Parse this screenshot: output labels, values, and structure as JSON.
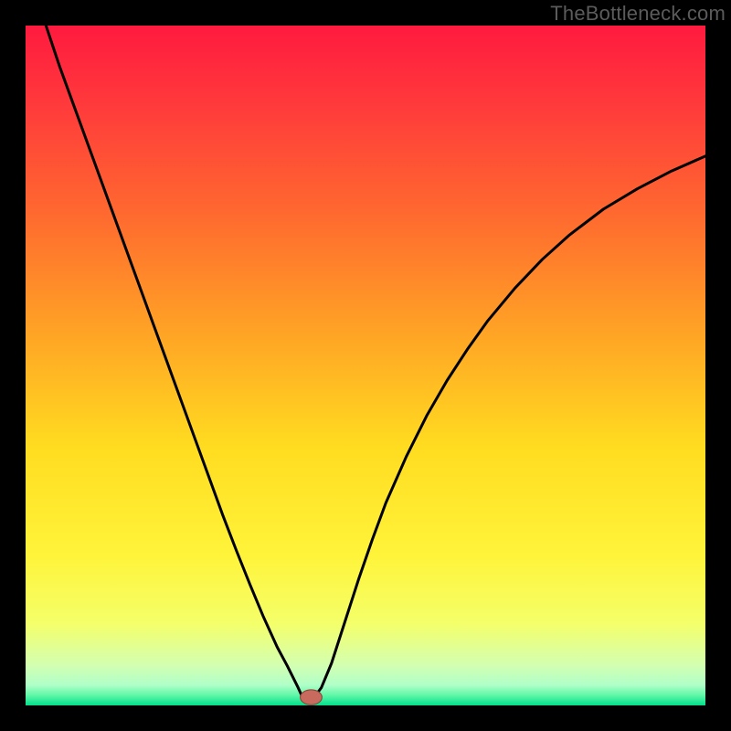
{
  "watermark": "TheBottleneck.com",
  "colors": {
    "frame": "#000000",
    "gradient_stops": [
      {
        "offset": 0.0,
        "color": "#ff1a3f"
      },
      {
        "offset": 0.12,
        "color": "#ff3b3b"
      },
      {
        "offset": 0.28,
        "color": "#ff6a2f"
      },
      {
        "offset": 0.45,
        "color": "#ffa325"
      },
      {
        "offset": 0.62,
        "color": "#ffdc20"
      },
      {
        "offset": 0.78,
        "color": "#fff43a"
      },
      {
        "offset": 0.88,
        "color": "#f4ff6a"
      },
      {
        "offset": 0.94,
        "color": "#d4ffb0"
      },
      {
        "offset": 0.97,
        "color": "#b0ffc8"
      },
      {
        "offset": 0.985,
        "color": "#60f7a8"
      },
      {
        "offset": 1.0,
        "color": "#00e08a"
      }
    ],
    "curve": "#000000",
    "marker_fill": "#c96a5e",
    "marker_stroke": "#8a3f36"
  },
  "chart_data": {
    "type": "line",
    "title": "",
    "xlabel": "",
    "ylabel": "",
    "xlim": [
      0,
      100
    ],
    "ylim": [
      0,
      100
    ],
    "grid": false,
    "legend": false,
    "annotations": [],
    "x_min_at": 41,
    "marker": {
      "x": 42,
      "y": 1.2,
      "rx": 1.6,
      "ry": 1.1
    },
    "x": [
      3,
      5,
      7,
      9,
      11,
      13,
      15,
      17,
      19,
      21,
      23,
      25,
      27,
      29,
      31,
      33,
      35,
      37,
      38.5,
      40,
      41,
      42,
      43.5,
      45,
      47,
      49,
      51,
      53,
      56,
      59,
      62,
      65,
      68,
      72,
      76,
      80,
      85,
      90,
      95,
      100
    ],
    "values": [
      100,
      94,
      88.5,
      83,
      77.5,
      72,
      66.5,
      61,
      55.5,
      50,
      44.5,
      39,
      33.5,
      28,
      22.8,
      17.8,
      13,
      8.6,
      5.8,
      2.8,
      0.6,
      0.6,
      2.6,
      6.2,
      12.4,
      18.6,
      24.4,
      29.8,
      36.6,
      42.6,
      47.8,
      52.4,
      56.6,
      61.4,
      65.6,
      69.2,
      73,
      76.0,
      78.6,
      80.8
    ]
  }
}
